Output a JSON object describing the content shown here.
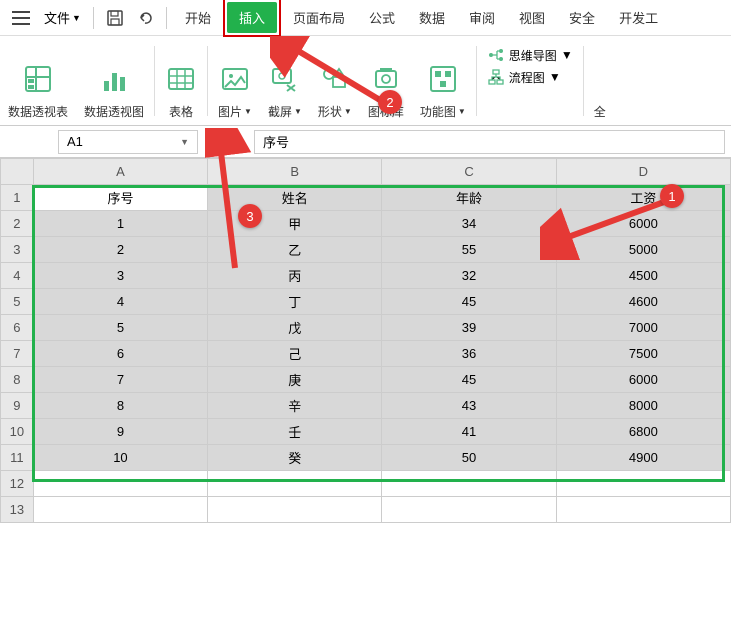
{
  "menubar": {
    "file": "文件",
    "tabs": [
      "开始",
      "插入",
      "页面布局",
      "公式",
      "数据",
      "审阅",
      "视图",
      "安全",
      "开发工"
    ]
  },
  "ribbon": {
    "pivot_table": "数据透视表",
    "pivot_chart": "数据透视图",
    "table": "表格",
    "picture": "图片",
    "screenshot": "截屏",
    "shapes": "形状",
    "icons": "图标库",
    "smartart": "功能图",
    "mindmap": "思维导图",
    "flowchart": "流程图",
    "all": "全"
  },
  "formula_bar": {
    "cell_ref": "A1",
    "content": "序号"
  },
  "chart_data": {
    "type": "table",
    "columns": [
      "A",
      "B",
      "C",
      "D"
    ],
    "headers": [
      "序号",
      "姓名",
      "年龄",
      "工资"
    ],
    "rows": [
      [
        "1",
        "甲",
        "34",
        "6000"
      ],
      [
        "2",
        "乙",
        "55",
        "5000"
      ],
      [
        "3",
        "丙",
        "32",
        "4500"
      ],
      [
        "4",
        "丁",
        "45",
        "4600"
      ],
      [
        "5",
        "戊",
        "39",
        "7000"
      ],
      [
        "6",
        "己",
        "36",
        "7500"
      ],
      [
        "7",
        "庚",
        "45",
        "6000"
      ],
      [
        "8",
        "辛",
        "43",
        "8000"
      ],
      [
        "9",
        "壬",
        "41",
        "6800"
      ],
      [
        "10",
        "癸",
        "50",
        "4900"
      ]
    ]
  },
  "annotations": {
    "b1": "1",
    "b2": "2",
    "b3": "3"
  }
}
